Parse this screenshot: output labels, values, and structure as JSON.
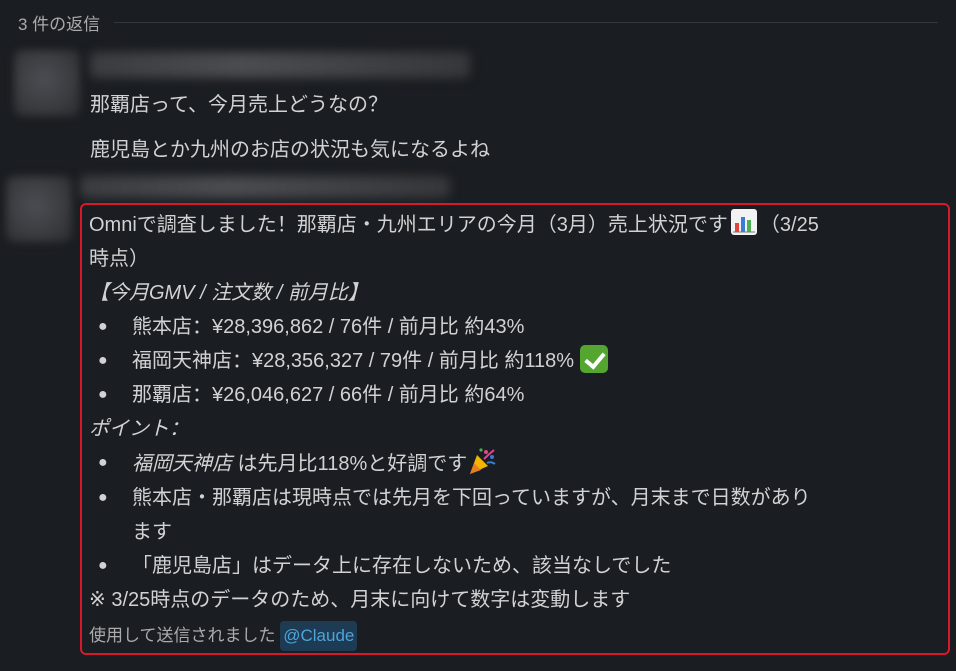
{
  "thread": {
    "replies_count": "3 件の返信"
  },
  "messages": [
    {
      "lines": [
        "那覇店って、今月売上どうなの？",
        "鹿児島とか九州のお店の状況も気になるよね"
      ]
    }
  ],
  "bot_reply": {
    "intro_text": "Omniで調査しました！那覇店・九州エリアの今月（3月）売上状況です",
    "intro_suffix": "（3/25",
    "intro_line2": "時点）",
    "section_heading": "【今月GMV / 注文数 / 前月比】",
    "stores": [
      "熊本店：¥28,396,862 / 76件 / 前月比 約43%",
      "福岡天神店：¥28,356,327 / 79件 / 前月比 約118%",
      "那覇店：¥26,046,627 / 66件 / 前月比 約64%"
    ],
    "points_heading": "ポイント：",
    "points": [
      {
        "italic": "福岡天神店",
        "text": " は先月比118%と好調です"
      },
      {
        "text": "熊本店・那覇店は現時点では先月を下回っていますが、月末まで日数があり"
      },
      {
        "text": "ます"
      },
      {
        "text": "「鹿児島店」はデータ上に存在しないため、該当なしでした"
      }
    ],
    "note": "※ 3/25時点のデータのため、月末に向けて数字は変動します",
    "sent_via_label": "使用して送信されました",
    "mention": "@Claude"
  },
  "bullet_glyph": "●",
  "icons": {
    "chart": "bar-chart-icon",
    "check": "check-mark-icon",
    "party": "party-popper-icon"
  },
  "colors": {
    "highlight_border": "#d6192c",
    "mention_bg": "#1d3b52",
    "mention_text": "#4fa3d9",
    "check_green": "#55a630"
  }
}
